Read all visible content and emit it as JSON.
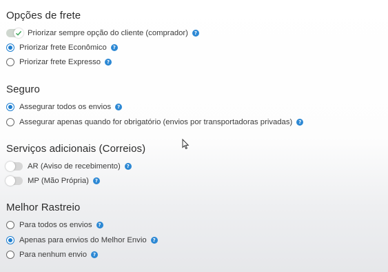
{
  "sections": {
    "frete": {
      "title": "Opções de frete",
      "options": [
        {
          "label": "Priorizar sempre opção do cliente (comprador)",
          "type": "toggle",
          "checked": true
        },
        {
          "label": "Priorizar frete Econômico",
          "type": "radio",
          "checked": true
        },
        {
          "label": "Priorizar frete Expresso",
          "type": "radio",
          "checked": false
        }
      ]
    },
    "seguro": {
      "title": "Seguro",
      "options": [
        {
          "label": "Assegurar todos os envios",
          "type": "radio",
          "checked": true
        },
        {
          "label": "Assegurar apenas quando for obrigatório (envios por transportadoras privadas)",
          "type": "radio",
          "checked": false
        }
      ]
    },
    "servicos": {
      "title": "Serviços adicionais (Correios)",
      "options": [
        {
          "label": "AR (Aviso de recebimento)",
          "type": "toggle",
          "checked": false
        },
        {
          "label": "MP (Mão Própria)",
          "type": "toggle",
          "checked": false
        }
      ]
    },
    "rastreio": {
      "title": "Melhor Rastreio",
      "options": [
        {
          "label": "Para todos os envios",
          "type": "radio",
          "checked": false
        },
        {
          "label": "Apenas para envios do Melhor Envio",
          "type": "radio",
          "checked": true
        },
        {
          "label": "Para nenhum envio",
          "type": "radio",
          "checked": false
        }
      ]
    }
  },
  "help_glyph": "?",
  "icons": {
    "help": "question-icon",
    "check": "check-icon",
    "cursor": "mouse-cursor-icon"
  },
  "colors": {
    "accent": "#1f7fd0",
    "help": "#2c88d4",
    "toggle_off": "#d6d6d6"
  }
}
